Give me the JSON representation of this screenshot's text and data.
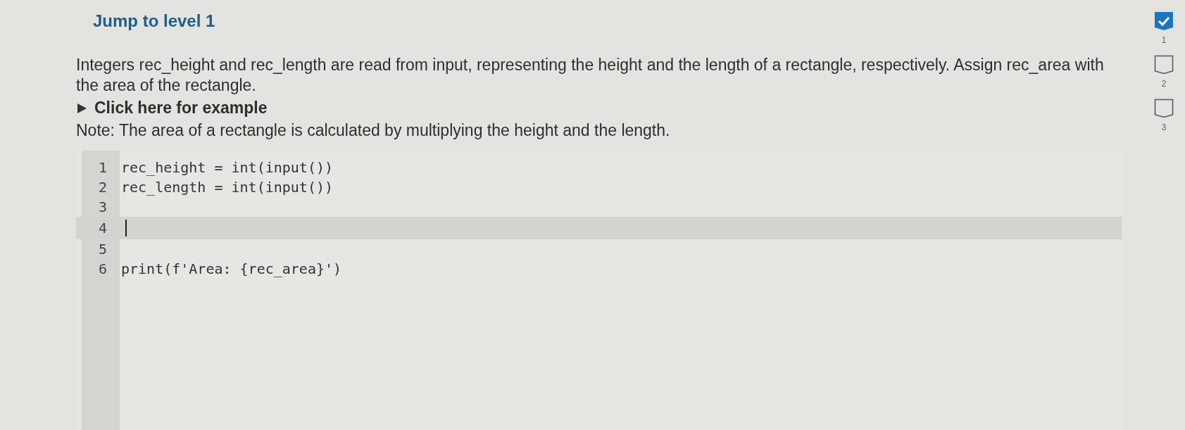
{
  "title": "Jump to level 1",
  "prompt": "Integers rec_height and rec_length are read from input, representing the height and the length of a rectangle, respectively. Assign rec_area with the area of the rectangle.",
  "example": {
    "label": "Click here for example",
    "expanded": false
  },
  "note": "Note: The area of a rectangle is calculated by multiplying the height and the length.",
  "code": {
    "lines": [
      {
        "number": "1",
        "text": "rec_height = int(input())",
        "active": false
      },
      {
        "number": "2",
        "text": "rec_length = int(input())",
        "active": false
      },
      {
        "number": "3",
        "active": false
      },
      {
        "number": "4",
        "active": true
      },
      {
        "number": "5",
        "active": false
      },
      {
        "number": "6",
        "text": "print(f'Area: {rec_area}')",
        "active": false
      }
    ]
  },
  "levels": [
    {
      "label": "1",
      "done": true
    },
    {
      "label": "2",
      "done": false
    },
    {
      "label": "3",
      "done": false
    }
  ]
}
